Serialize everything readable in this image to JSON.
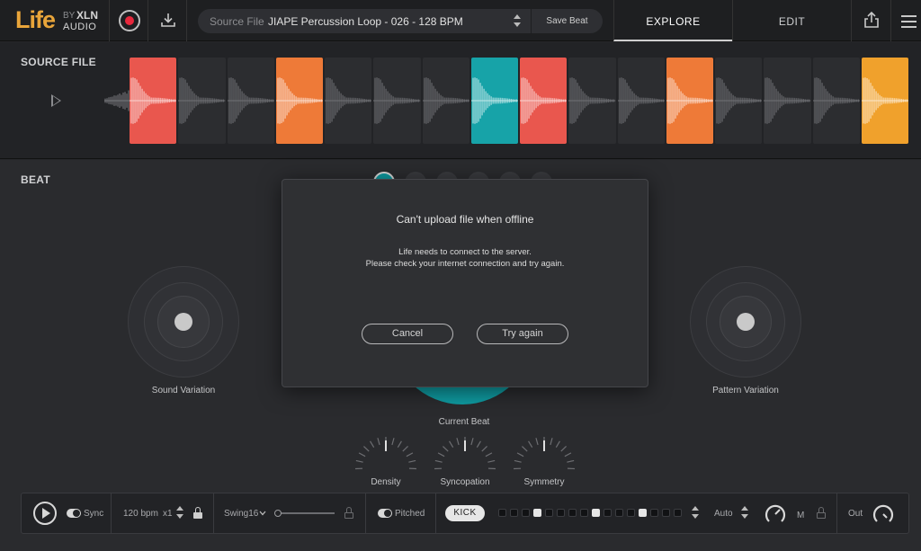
{
  "app": {
    "logo_main": "Life",
    "logo_by": "BY",
    "logo_brand": "XLN",
    "logo_sub": "AUDIO"
  },
  "toolbar": {
    "source_label": "Source File",
    "source_value": "JIAPE Percussion Loop - 026 - 128 BPM",
    "save_label": "Save Beat"
  },
  "tabs": {
    "explore": "EXPLORE",
    "edit": "EDIT"
  },
  "source": {
    "title": "SOURCE FILE",
    "slices": [
      "#e9574e",
      "",
      "",
      "#ee7a38",
      "",
      "",
      "",
      "#17a3a8",
      "#e9574e",
      "",
      "",
      "#ee7a38",
      "",
      "",
      "",
      "#f0a12c"
    ]
  },
  "beat": {
    "title": "BEAT",
    "sound_variation": "Sound Variation",
    "pattern_variation": "Pattern Variation",
    "current_beat": "Current Beat",
    "density": "Density",
    "syncopation": "Syncopation",
    "symmetry": "Symmetry"
  },
  "transport": {
    "sync": "Sync",
    "bpm": "120 bpm",
    "multiplier": "x1",
    "swing": "Swing16",
    "pitched": "Pitched",
    "kick": "KICK",
    "steps": [
      0,
      0,
      0,
      1,
      0,
      0,
      0,
      0,
      1,
      0,
      0,
      0,
      1,
      0,
      0,
      0
    ],
    "auto": "Auto",
    "m": "M",
    "out": "Out"
  },
  "dialog": {
    "title": "Can't upload file when offline",
    "line1": "Life needs to connect to the server.",
    "line2": "Please check your internet connection and try again.",
    "cancel": "Cancel",
    "retry": "Try again"
  },
  "colors": {
    "accent": "#0f9aa0",
    "record": "#e8283c",
    "logo": "#e9a53a"
  }
}
